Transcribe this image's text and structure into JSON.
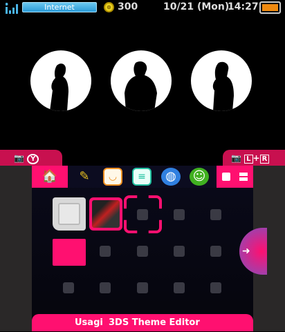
{
  "status": {
    "connection": "Internet",
    "coins": "300",
    "date": "10/21 (Mon)",
    "time": "14:27",
    "battery_level": "full"
  },
  "top_screen": {
    "icons": [
      "silhouette-1",
      "silhouette-2",
      "silhouette-3"
    ]
  },
  "tabs": {
    "left": "Y",
    "right_l": "L",
    "right_plus": "+",
    "right_r": "R"
  },
  "toolbar": {
    "icons": [
      "home-settings-icon",
      "notes-icon",
      "face-icon",
      "chat-icon",
      "globe-icon",
      "friends-icon"
    ]
  },
  "grid": {
    "apps": [
      "game-card",
      "photo-app",
      "folder"
    ]
  },
  "bottom": {
    "user": "Usagi",
    "title": "3DS Theme Editor"
  },
  "colors": {
    "accent": "#ff1070",
    "tab": "#c8104f"
  }
}
